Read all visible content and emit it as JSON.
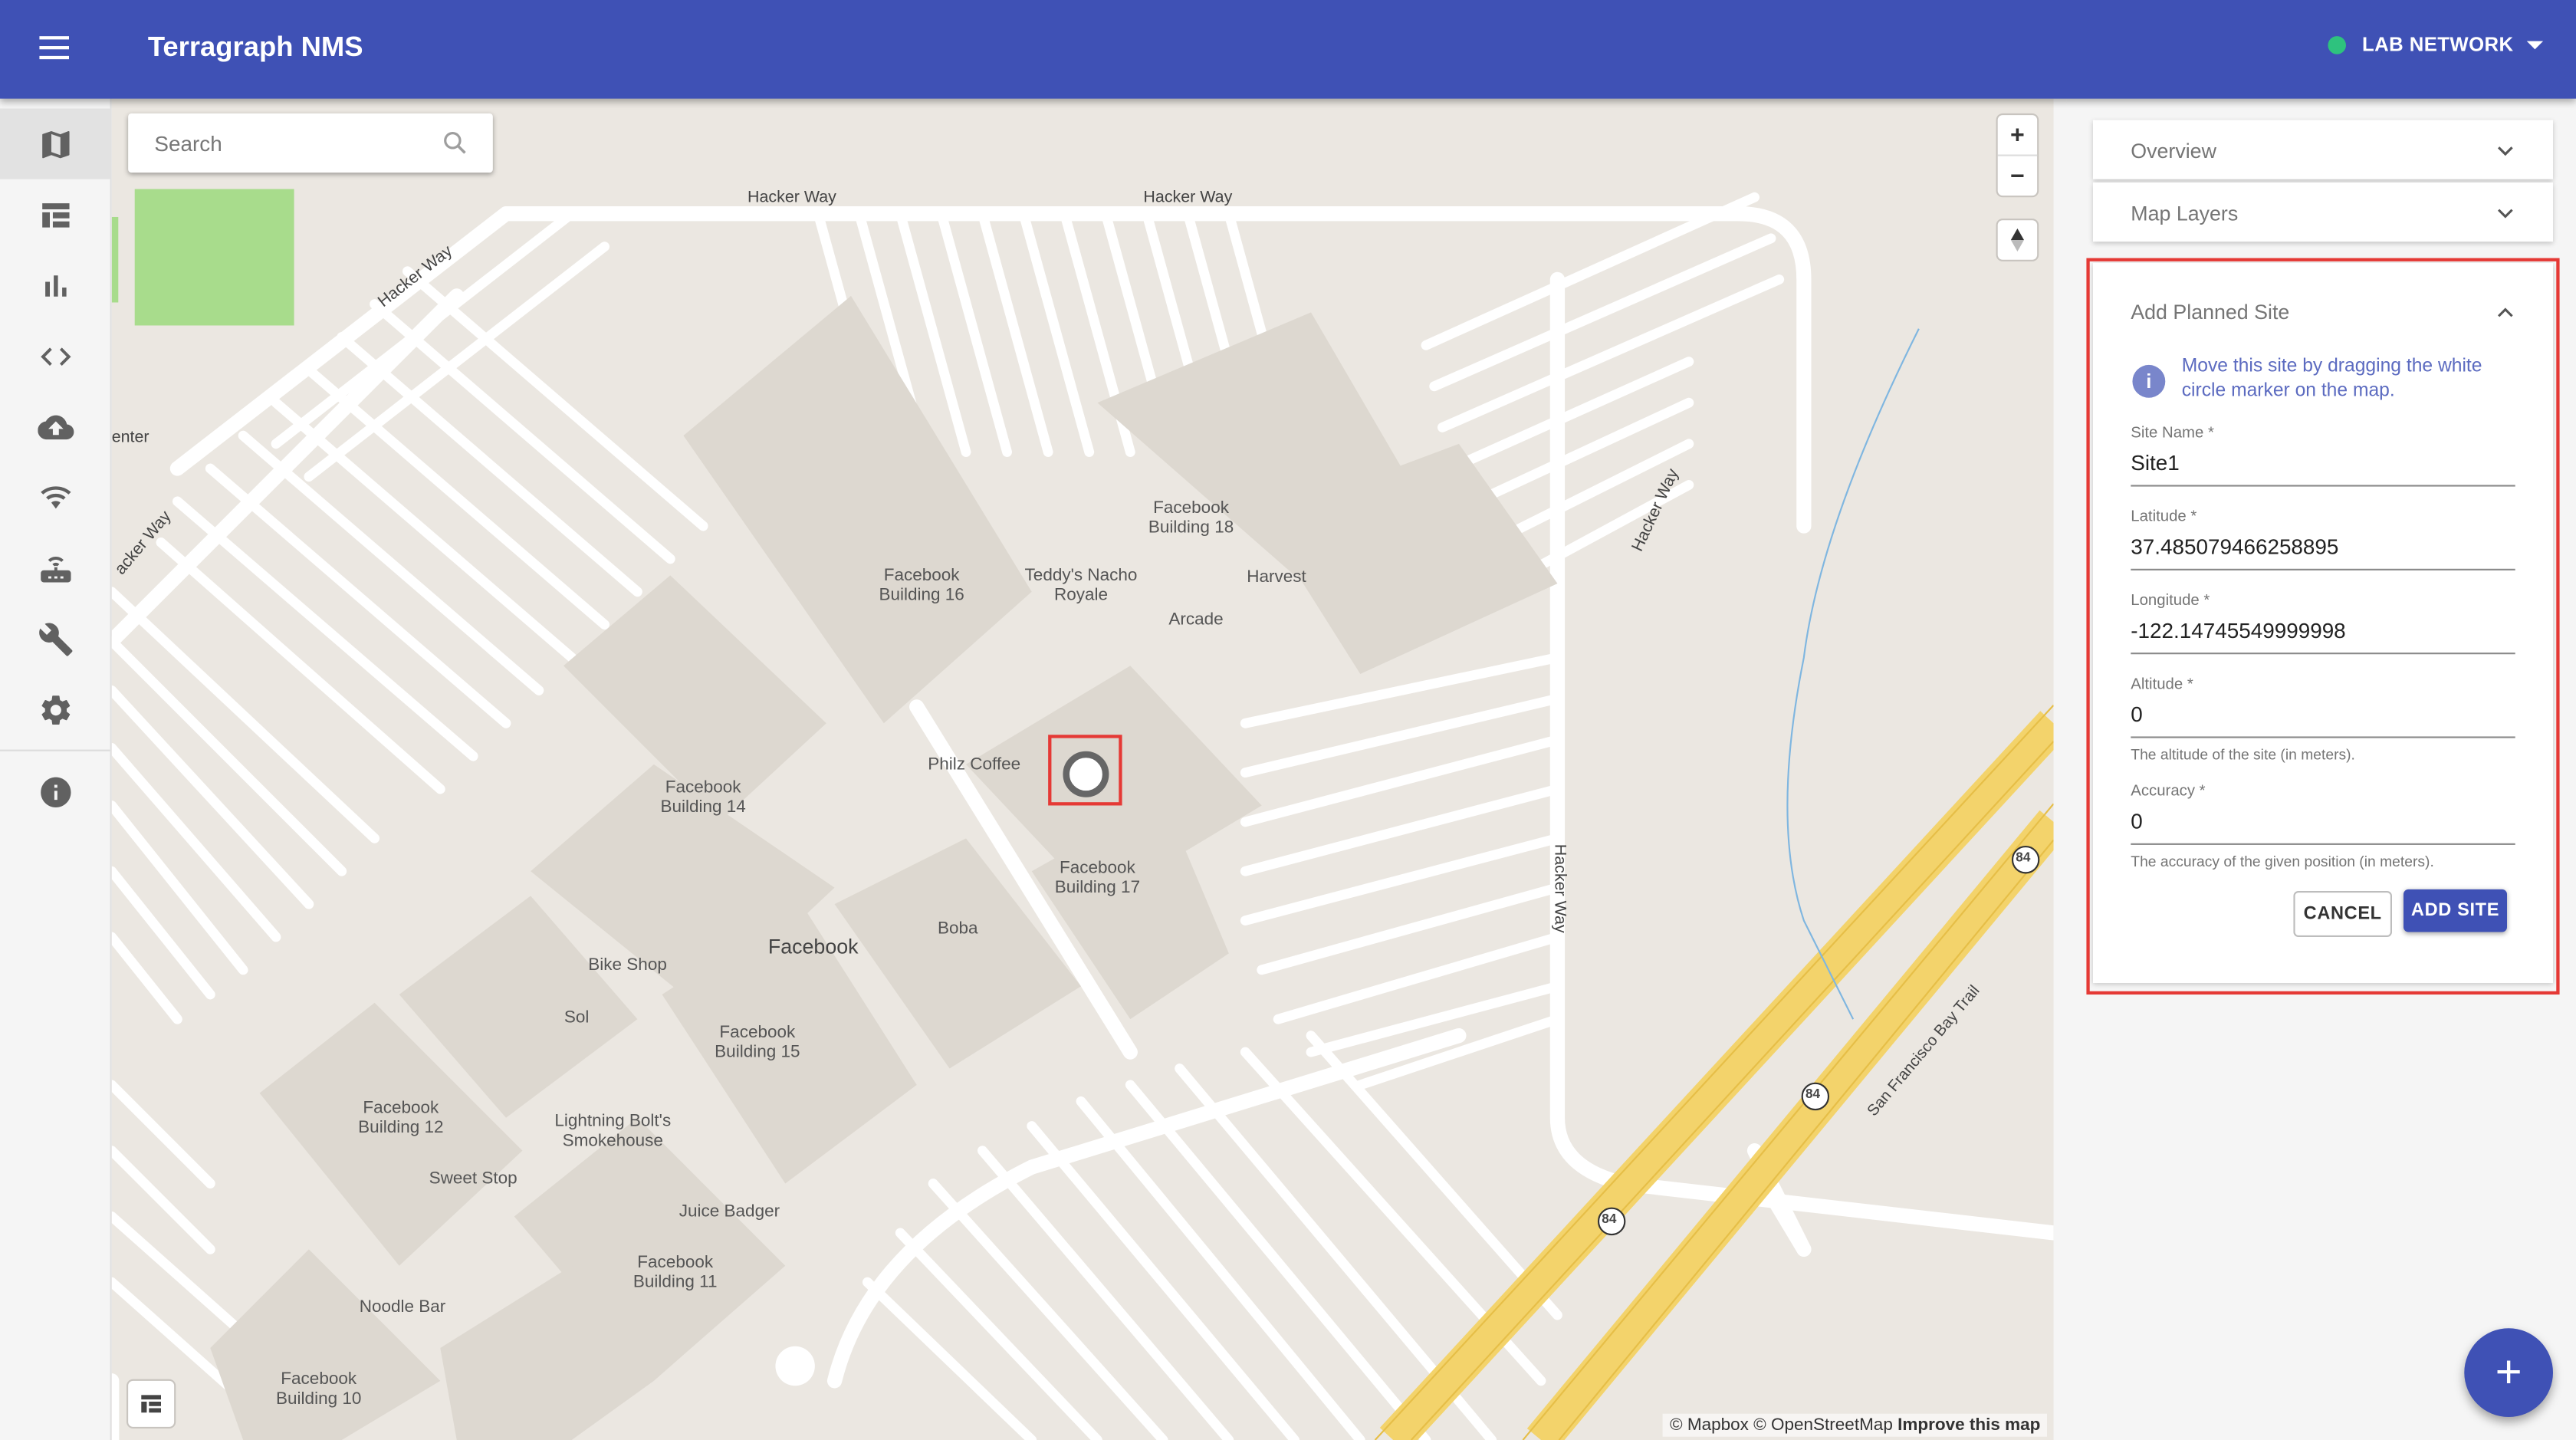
{
  "app": {
    "title": "Terragraph NMS",
    "network_name": "LAB NETWORK",
    "network_status_color": "#2ec27e"
  },
  "nav": {
    "items": [
      {
        "icon": "map-icon",
        "active": true
      },
      {
        "icon": "table-icon"
      },
      {
        "icon": "bar-chart-icon"
      },
      {
        "icon": "code-icon"
      },
      {
        "icon": "cloud-upload-icon"
      },
      {
        "icon": "wifi-tethering-icon"
      },
      {
        "icon": "router-icon"
      },
      {
        "icon": "wrench-icon"
      },
      {
        "icon": "gear-icon"
      },
      {
        "icon": "info-icon"
      }
    ]
  },
  "map": {
    "search_placeholder": "Search",
    "zoom_in": "+",
    "zoom_out": "−",
    "attribution": {
      "mapbox": "© Mapbox",
      "osm": "© OpenStreetMap",
      "improve": "Improve this map"
    },
    "road_labels": {
      "hacker_way_1": "Hacker Way",
      "hacker_way_2": "Hacker Way",
      "hacker_way_3": "Hacker Way",
      "hacker_way_4": "acker Way",
      "hacker_way_5": "Hacker Way",
      "hacker_way_6": "Hacker Way",
      "bay_trail": "San Francisco Bay Trail",
      "enter": "enter",
      "route_84_a": "84",
      "route_84_b": "84",
      "route_84_c": "84"
    },
    "pois": {
      "fb18": "Facebook\nBuilding 18",
      "fb16": "Facebook\nBuilding 16",
      "teddys": "Teddy's Nacho\nRoyale",
      "harvest": "Harvest",
      "arcade": "Arcade",
      "philz": "Philz Coffee",
      "fb14": "Facebook\nBuilding 14",
      "fb17": "Facebook\nBuilding 17",
      "boba": "Boba",
      "facebook": "Facebook",
      "bikeshop": "Bike Shop",
      "sol": "Sol",
      "fb15": "Facebook\nBuilding 15",
      "fb12": "Facebook\nBuilding 12",
      "lightning": "Lightning Bolt's\nSmokehouse",
      "sweetstop": "Sweet Stop",
      "juicebadger": "Juice Badger",
      "fb11": "Facebook\nBuilding 11",
      "noodlebar": "Noodle Bar",
      "fb10": "Facebook\nBuilding 10"
    }
  },
  "panel": {
    "overview_label": "Overview",
    "map_layers_label": "Map Layers",
    "add_site": {
      "title": "Add Planned Site",
      "info_text": "Move this site by dragging the white circle marker on the map.",
      "fields": {
        "site_name": {
          "label": "Site Name *",
          "value": "Site1"
        },
        "latitude": {
          "label": "Latitude *",
          "value": "37.485079466258895"
        },
        "longitude": {
          "label": "Longitude *",
          "value": "-122.14745549999998"
        },
        "altitude": {
          "label": "Altitude *",
          "value": "0",
          "help": "The altitude of the site (in meters)."
        },
        "accuracy": {
          "label": "Accuracy *",
          "value": "0",
          "help": "The accuracy of the given position (in meters)."
        }
      },
      "cancel_label": "CANCEL",
      "add_label": "ADD SITE"
    },
    "fab_label": "+"
  },
  "colors": {
    "primary": "#3f51b5",
    "highlight": "#e53935",
    "map_bg": "#ebe7e1",
    "highway": "#f3d36b"
  }
}
